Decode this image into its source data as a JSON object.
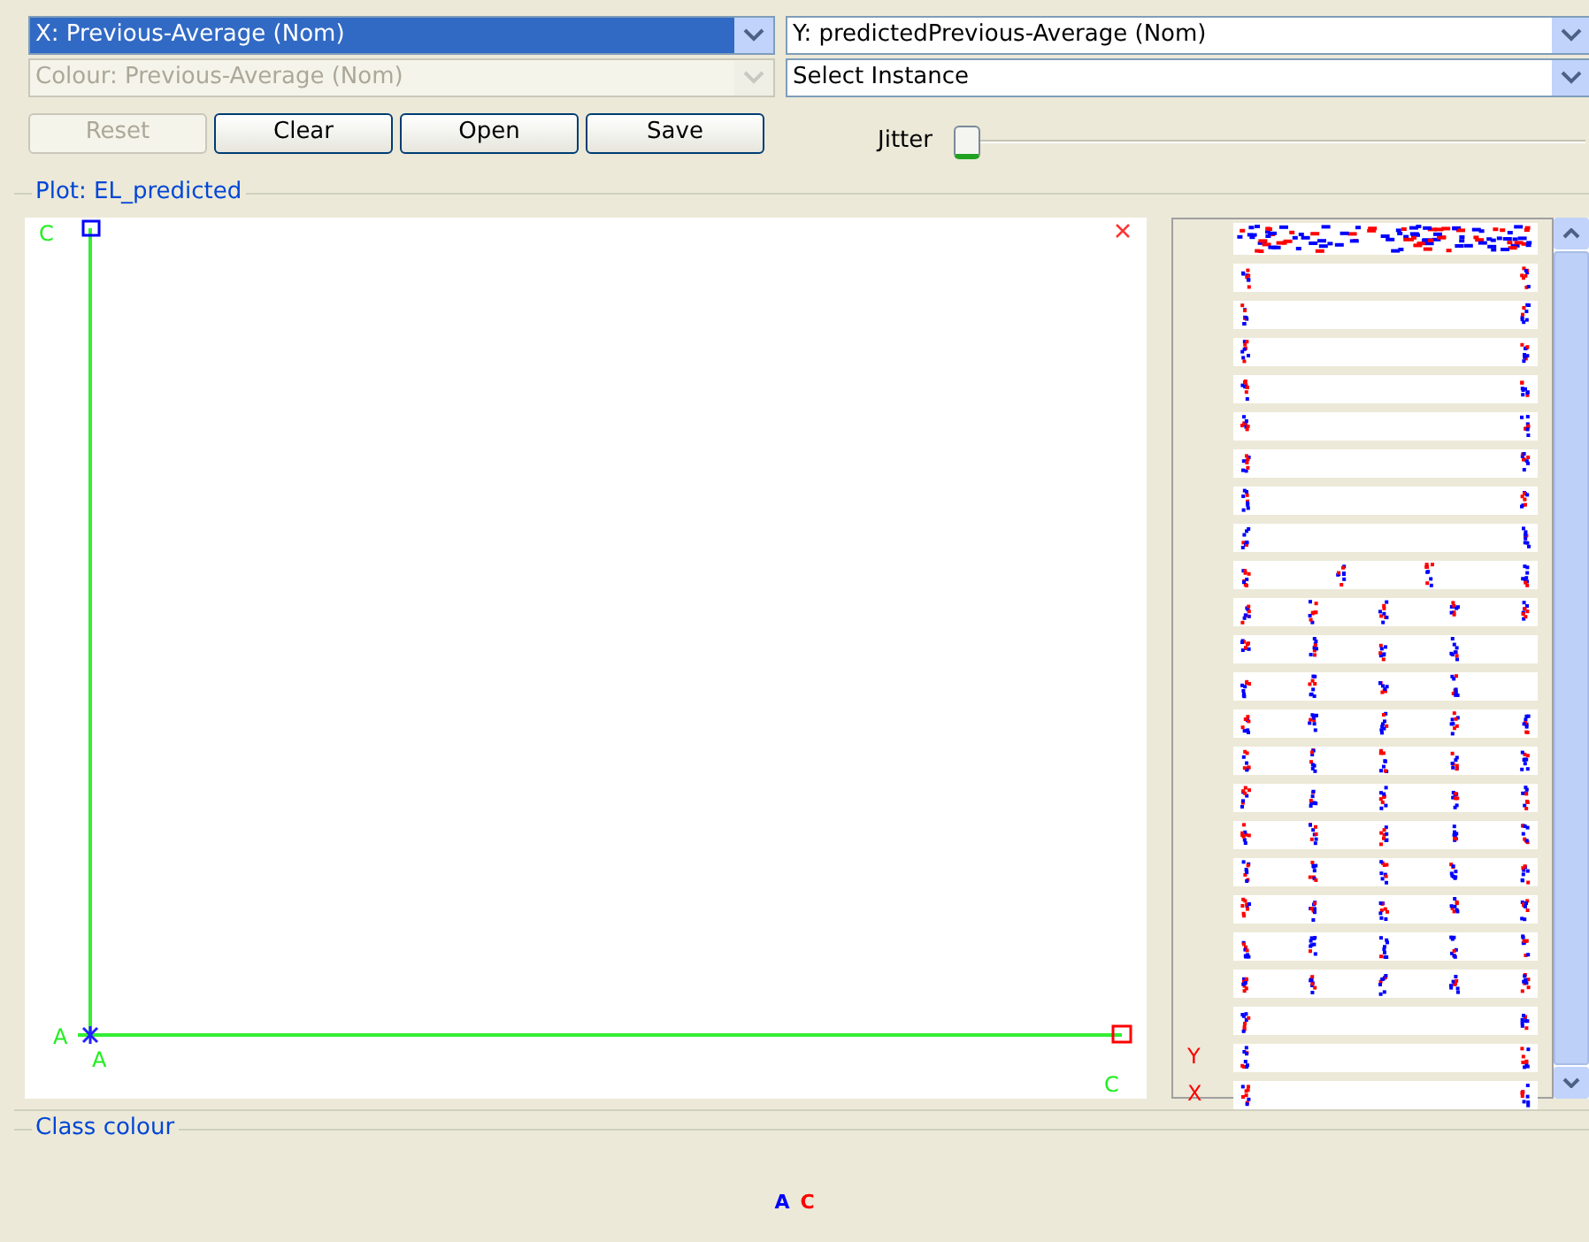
{
  "x_axis_select": {
    "value": "X: Previous-Average (Nom)",
    "selected": true
  },
  "y_axis_select": {
    "value": "Y: predictedPrevious-Average (Nom)"
  },
  "colour_select": {
    "value": "Colour: Previous-Average (Nom)",
    "disabled": true
  },
  "instance_select": {
    "value": "Select Instance"
  },
  "buttons": [
    {
      "label": "Reset",
      "disabled": true
    },
    {
      "label": "Clear",
      "disabled": false
    },
    {
      "label": "Open",
      "disabled": false
    },
    {
      "label": "Save",
      "disabled": false
    }
  ],
  "jitter": {
    "label": "Jitter",
    "level": 0
  },
  "plot": {
    "title": "Plot: EL_predicted",
    "y_axis_top": "C",
    "y_axis_bottom": "A",
    "x_axis_left": "A",
    "x_axis_right": "C"
  },
  "attribute_panel": {
    "axis_markers": [
      {
        "label": "Y",
        "color": "#ff0000"
      },
      {
        "label": "X",
        "color": "#ff0000"
      }
    ]
  },
  "class_colour": {
    "title": "Class colour",
    "classes": [
      {
        "label": "A",
        "color": "#0000ff"
      },
      {
        "label": "C",
        "color": "#ff0000"
      }
    ]
  }
}
